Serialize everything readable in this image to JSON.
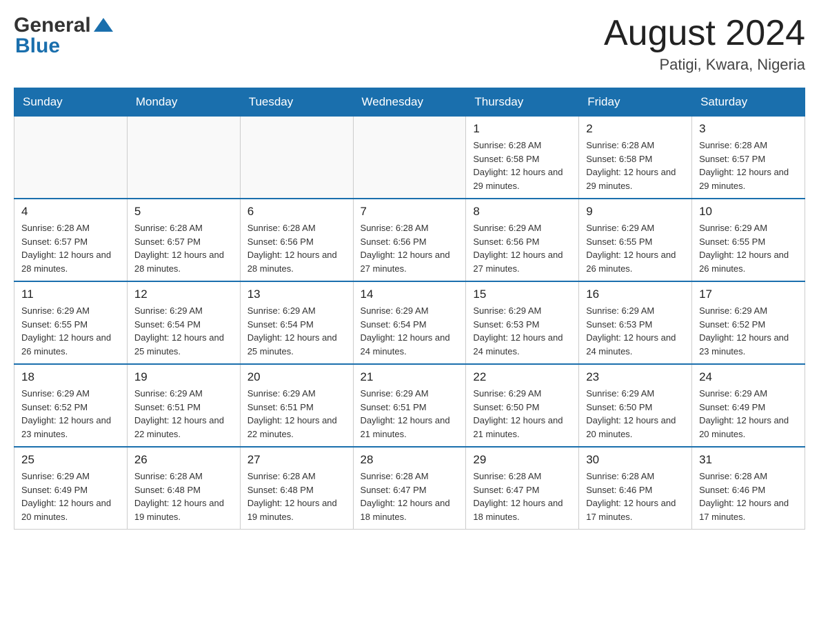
{
  "header": {
    "logo": {
      "top": "General",
      "bottom": "Blue"
    },
    "month_year": "August 2024",
    "location": "Patigi, Kwara, Nigeria"
  },
  "days_of_week": [
    "Sunday",
    "Monday",
    "Tuesday",
    "Wednesday",
    "Thursday",
    "Friday",
    "Saturday"
  ],
  "weeks": [
    [
      {
        "day": "",
        "info": ""
      },
      {
        "day": "",
        "info": ""
      },
      {
        "day": "",
        "info": ""
      },
      {
        "day": "",
        "info": ""
      },
      {
        "day": "1",
        "info": "Sunrise: 6:28 AM\nSunset: 6:58 PM\nDaylight: 12 hours and 29 minutes."
      },
      {
        "day": "2",
        "info": "Sunrise: 6:28 AM\nSunset: 6:58 PM\nDaylight: 12 hours and 29 minutes."
      },
      {
        "day": "3",
        "info": "Sunrise: 6:28 AM\nSunset: 6:57 PM\nDaylight: 12 hours and 29 minutes."
      }
    ],
    [
      {
        "day": "4",
        "info": "Sunrise: 6:28 AM\nSunset: 6:57 PM\nDaylight: 12 hours and 28 minutes."
      },
      {
        "day": "5",
        "info": "Sunrise: 6:28 AM\nSunset: 6:57 PM\nDaylight: 12 hours and 28 minutes."
      },
      {
        "day": "6",
        "info": "Sunrise: 6:28 AM\nSunset: 6:56 PM\nDaylight: 12 hours and 28 minutes."
      },
      {
        "day": "7",
        "info": "Sunrise: 6:28 AM\nSunset: 6:56 PM\nDaylight: 12 hours and 27 minutes."
      },
      {
        "day": "8",
        "info": "Sunrise: 6:29 AM\nSunset: 6:56 PM\nDaylight: 12 hours and 27 minutes."
      },
      {
        "day": "9",
        "info": "Sunrise: 6:29 AM\nSunset: 6:55 PM\nDaylight: 12 hours and 26 minutes."
      },
      {
        "day": "10",
        "info": "Sunrise: 6:29 AM\nSunset: 6:55 PM\nDaylight: 12 hours and 26 minutes."
      }
    ],
    [
      {
        "day": "11",
        "info": "Sunrise: 6:29 AM\nSunset: 6:55 PM\nDaylight: 12 hours and 26 minutes."
      },
      {
        "day": "12",
        "info": "Sunrise: 6:29 AM\nSunset: 6:54 PM\nDaylight: 12 hours and 25 minutes."
      },
      {
        "day": "13",
        "info": "Sunrise: 6:29 AM\nSunset: 6:54 PM\nDaylight: 12 hours and 25 minutes."
      },
      {
        "day": "14",
        "info": "Sunrise: 6:29 AM\nSunset: 6:54 PM\nDaylight: 12 hours and 24 minutes."
      },
      {
        "day": "15",
        "info": "Sunrise: 6:29 AM\nSunset: 6:53 PM\nDaylight: 12 hours and 24 minutes."
      },
      {
        "day": "16",
        "info": "Sunrise: 6:29 AM\nSunset: 6:53 PM\nDaylight: 12 hours and 24 minutes."
      },
      {
        "day": "17",
        "info": "Sunrise: 6:29 AM\nSunset: 6:52 PM\nDaylight: 12 hours and 23 minutes."
      }
    ],
    [
      {
        "day": "18",
        "info": "Sunrise: 6:29 AM\nSunset: 6:52 PM\nDaylight: 12 hours and 23 minutes."
      },
      {
        "day": "19",
        "info": "Sunrise: 6:29 AM\nSunset: 6:51 PM\nDaylight: 12 hours and 22 minutes."
      },
      {
        "day": "20",
        "info": "Sunrise: 6:29 AM\nSunset: 6:51 PM\nDaylight: 12 hours and 22 minutes."
      },
      {
        "day": "21",
        "info": "Sunrise: 6:29 AM\nSunset: 6:51 PM\nDaylight: 12 hours and 21 minutes."
      },
      {
        "day": "22",
        "info": "Sunrise: 6:29 AM\nSunset: 6:50 PM\nDaylight: 12 hours and 21 minutes."
      },
      {
        "day": "23",
        "info": "Sunrise: 6:29 AM\nSunset: 6:50 PM\nDaylight: 12 hours and 20 minutes."
      },
      {
        "day": "24",
        "info": "Sunrise: 6:29 AM\nSunset: 6:49 PM\nDaylight: 12 hours and 20 minutes."
      }
    ],
    [
      {
        "day": "25",
        "info": "Sunrise: 6:29 AM\nSunset: 6:49 PM\nDaylight: 12 hours and 20 minutes."
      },
      {
        "day": "26",
        "info": "Sunrise: 6:28 AM\nSunset: 6:48 PM\nDaylight: 12 hours and 19 minutes."
      },
      {
        "day": "27",
        "info": "Sunrise: 6:28 AM\nSunset: 6:48 PM\nDaylight: 12 hours and 19 minutes."
      },
      {
        "day": "28",
        "info": "Sunrise: 6:28 AM\nSunset: 6:47 PM\nDaylight: 12 hours and 18 minutes."
      },
      {
        "day": "29",
        "info": "Sunrise: 6:28 AM\nSunset: 6:47 PM\nDaylight: 12 hours and 18 minutes."
      },
      {
        "day": "30",
        "info": "Sunrise: 6:28 AM\nSunset: 6:46 PM\nDaylight: 12 hours and 17 minutes."
      },
      {
        "day": "31",
        "info": "Sunrise: 6:28 AM\nSunset: 6:46 PM\nDaylight: 12 hours and 17 minutes."
      }
    ]
  ]
}
